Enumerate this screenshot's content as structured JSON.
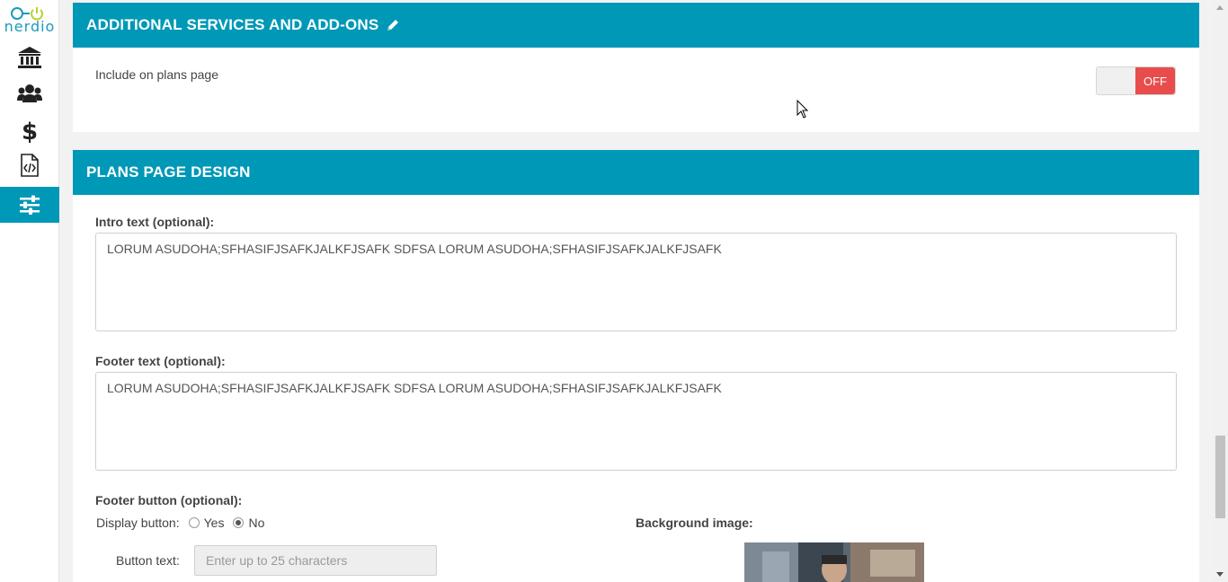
{
  "brand": {
    "logo_text": "nerdio",
    "colors": {
      "primary": "#0098b7",
      "toggle_off": "#e84c4c"
    }
  },
  "sidebar": {
    "items": [
      {
        "icon": "bank-icon",
        "active": false
      },
      {
        "icon": "users-icon",
        "active": false
      },
      {
        "icon": "dollar-icon",
        "active": false
      },
      {
        "icon": "code-file-icon",
        "active": false
      },
      {
        "icon": "sliders-icon",
        "active": true
      }
    ]
  },
  "addons": {
    "title": "ADDITIONAL SERVICES AND ADD-ONS",
    "include_label": "Include on plans page",
    "toggle_state": "OFF"
  },
  "design": {
    "title": "PLANS PAGE DESIGN",
    "intro_label": "Intro text (optional):",
    "intro_value": "LORUM ASUDOHA;SFHASIFJSAFKJALKFJSAFK SDFSA LORUM ASUDOHA;SFHASIFJSAFKJALKFJSAFK",
    "footer_label": "Footer text (optional):",
    "footer_value": "LORUM ASUDOHA;SFHASIFJSAFKJALKFJSAFK SDFSA LORUM ASUDOHA;SFHASIFJSAFKJALKFJSAFK",
    "footer_button_label": "Footer button (optional):",
    "display_button_label": "Display button:",
    "display_button_options": [
      {
        "label": "Yes",
        "selected": false
      },
      {
        "label": "No",
        "selected": true
      }
    ],
    "button_text_label": "Button text:",
    "button_text_placeholder": "Enter up to 25 characters",
    "background_image_label": "Background image:"
  }
}
